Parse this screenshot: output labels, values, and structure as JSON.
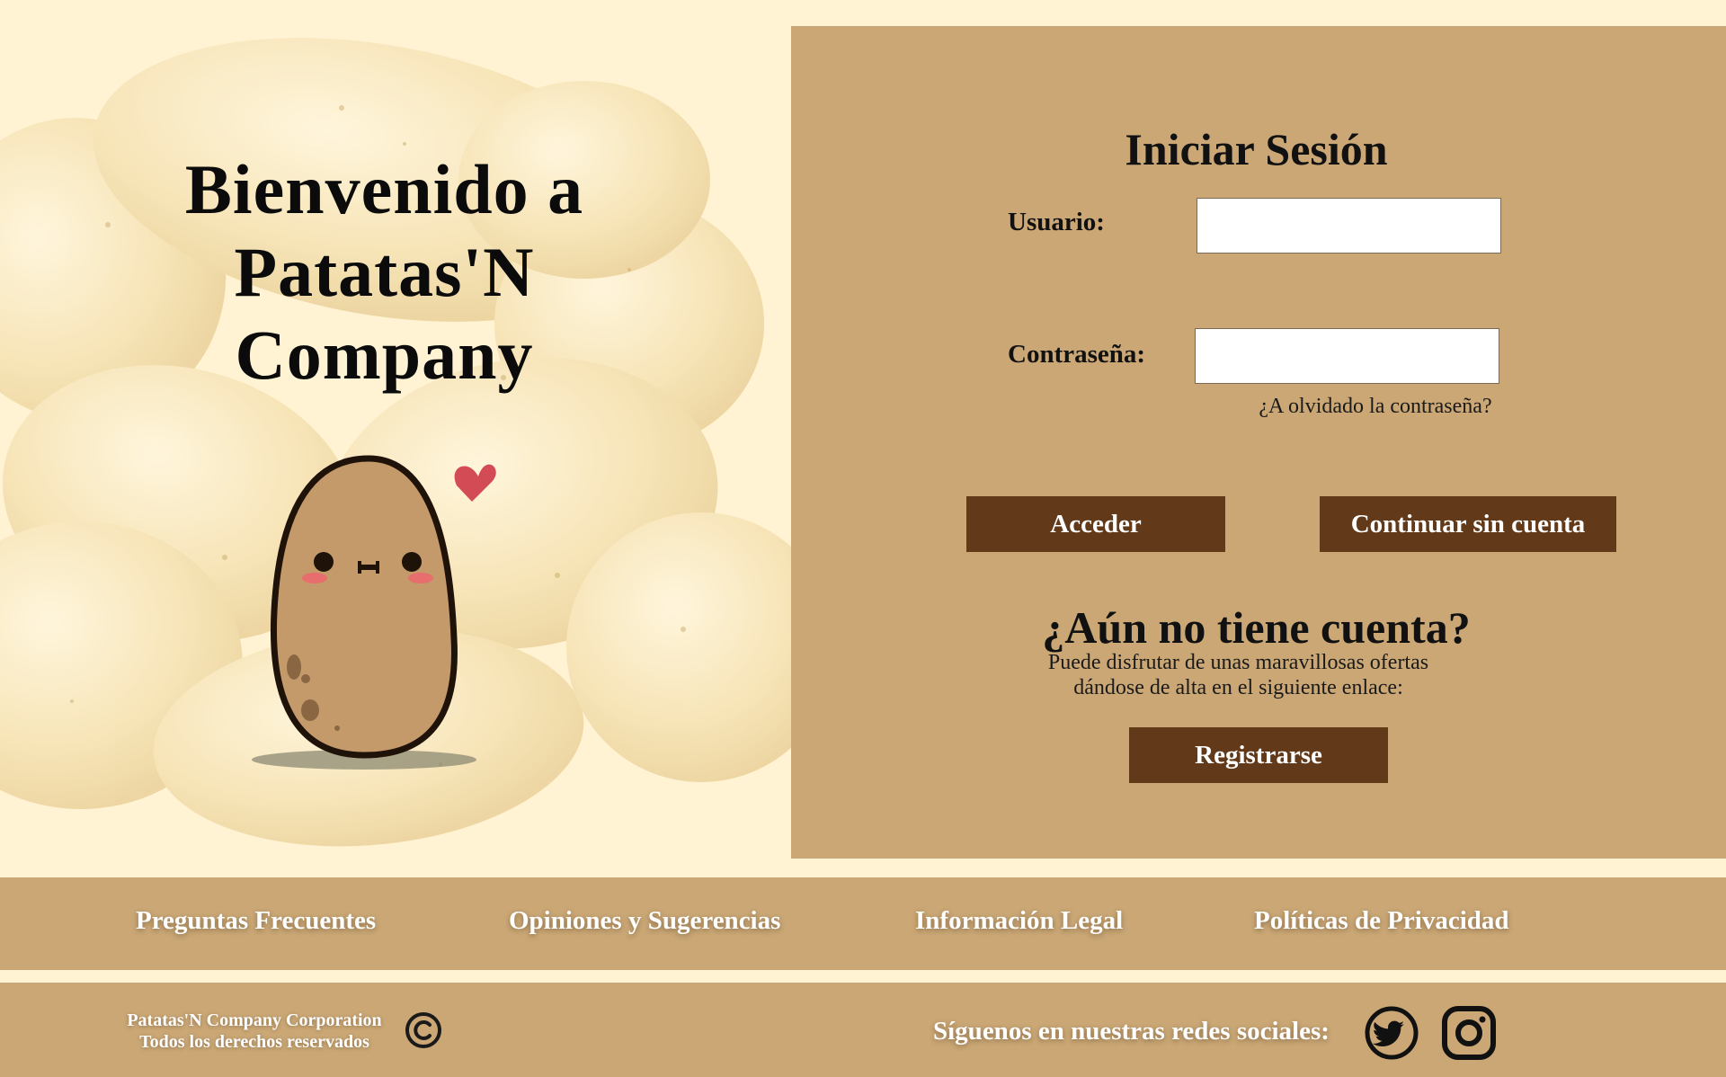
{
  "hero": {
    "title_line1": "Bienvenido a",
    "title_line2": "Patatas'N",
    "title_line3": "Company"
  },
  "login": {
    "title": "Iniciar Sesión",
    "username_label": "Usuario:",
    "username_value": "",
    "password_label": "Contraseña:",
    "password_value": "",
    "forgot_password": "¿A olvidado la contraseña?",
    "login_button": "Acceder",
    "guest_button": "Continuar sin cuenta"
  },
  "signup": {
    "title": "¿Aún no tiene cuenta?",
    "text_line1": "Puede disfrutar de unas maravillosas ofertas",
    "text_line2": "dándose de alta en el siguiente enlace:",
    "register_button": "Registrarse"
  },
  "footer_nav": {
    "items": [
      {
        "label": "Preguntas Frecuentes"
      },
      {
        "label": "Opiniones y Sugerencias"
      },
      {
        "label": "Información Legal"
      },
      {
        "label": "Políticas de Privacidad"
      }
    ]
  },
  "footer": {
    "company_line1": "Patatas'N Company Corporation",
    "company_line2": "Todos los derechos reservados",
    "social_label": "Síguenos en nuestras redes sociales:",
    "icons": [
      "copyright-icon",
      "twitter-icon",
      "instagram-icon"
    ]
  },
  "colors": {
    "page_bg": "#fff3d4",
    "panel": "#caa775",
    "button": "#623a19",
    "button_text": "#ffffff"
  }
}
